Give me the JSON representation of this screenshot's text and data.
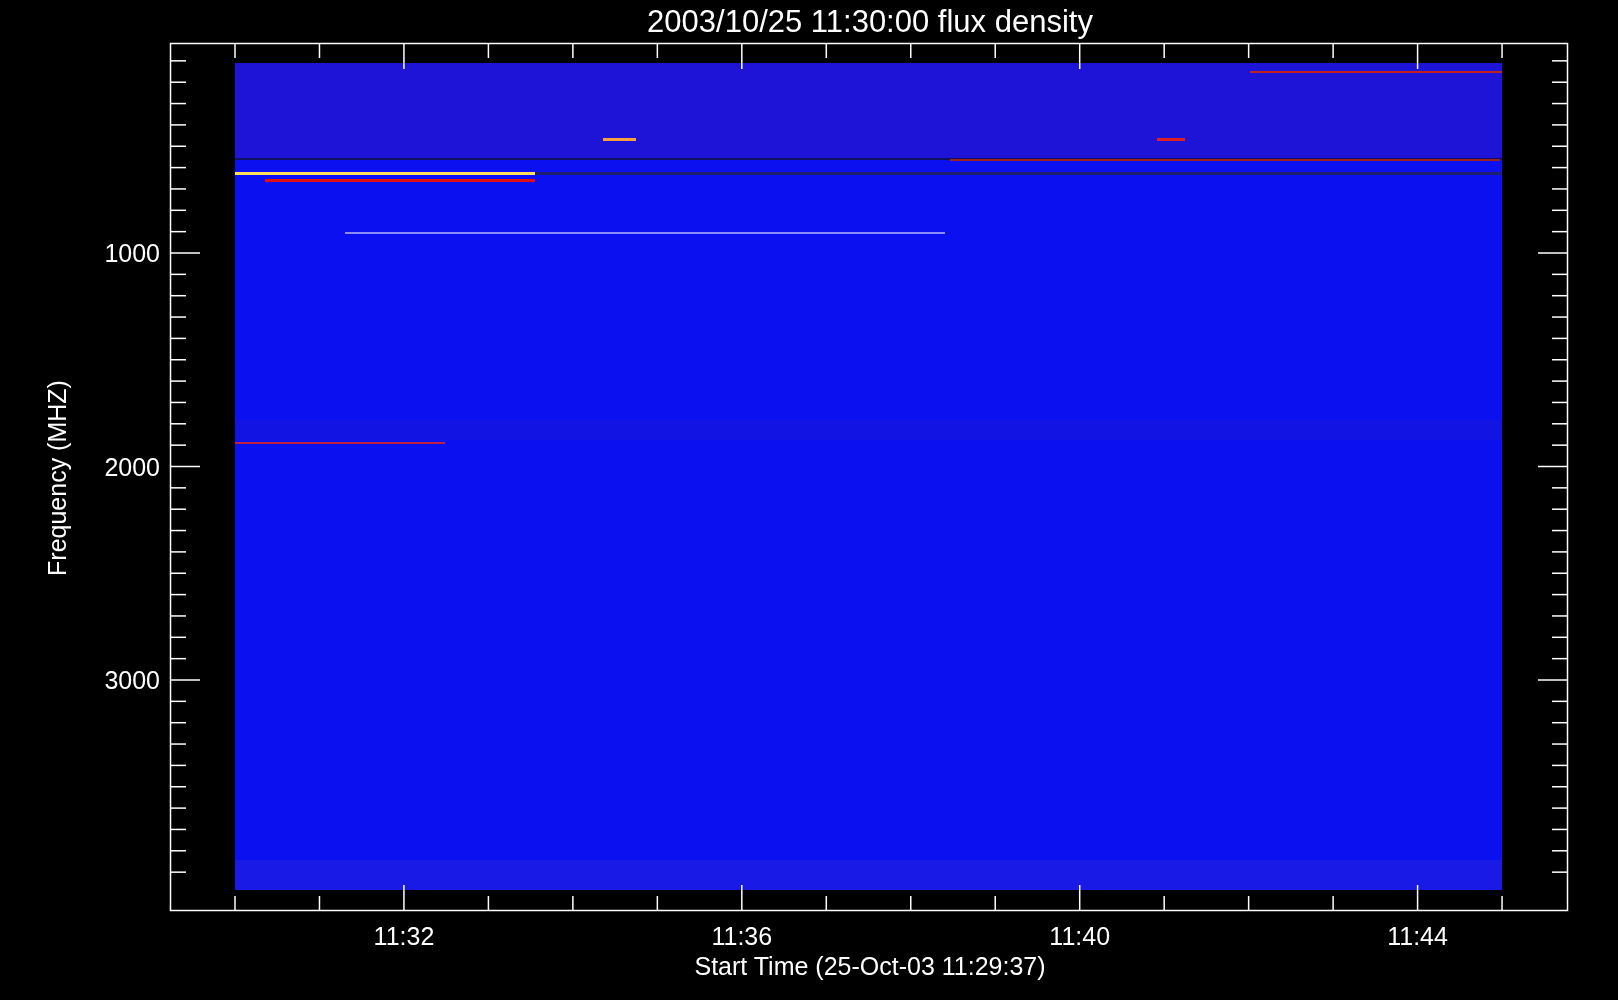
{
  "title": "2003/10/25 11:30:00 flux density",
  "xlabel": "Start Time (25-Oct-03 11:29:37)",
  "ylabel": "Frequency (MHZ)",
  "xtick_labels": [
    "11:32",
    "11:36",
    "11:40",
    "11:44"
  ],
  "ytick_labels": [
    "1000",
    "2000",
    "3000"
  ]
}
